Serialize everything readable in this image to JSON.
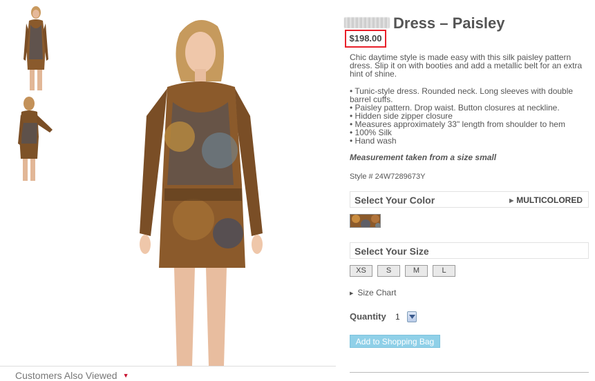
{
  "product": {
    "title": "Dress – Paisley",
    "price": "$198.00",
    "description": "Chic daytime style is made easy with this silk paisley pattern dress. Slip it on with booties and add a metallic belt for an extra hint of shine.",
    "bullets": [
      "• Tunic-style dress. Rounded neck. Long sleeves with double barrel cuffs.",
      "• Paisley pattern. Drop waist. Button closures at neckline.",
      "• Hidden side zipper closure",
      "• Measures approximately 33\" length from shoulder to hem",
      "• 100% Silk",
      "• Hand wash"
    ],
    "measurement_note": "Measurement taken from a size small",
    "style_number": "Style # 24W7289673Y"
  },
  "color_selector": {
    "label": "Select Your Color",
    "value": "MULTICOLORED"
  },
  "size_selector": {
    "label": "Select Your Size",
    "sizes": [
      "XS",
      "S",
      "M",
      "L"
    ],
    "size_chart_label": "Size Chart"
  },
  "quantity": {
    "label": "Quantity",
    "value": "1"
  },
  "add_to_bag_label": "Add to Shopping Bag",
  "customers_also_viewed": "Customers Also Viewed",
  "colors": {
    "price_border": "#e8202a",
    "add_button": "#8fd0e8"
  }
}
